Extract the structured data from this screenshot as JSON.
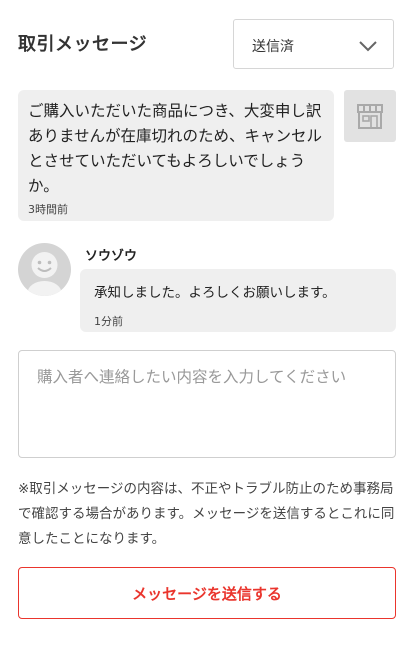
{
  "header": {
    "title": "取引メッセージ",
    "status_select": {
      "value": "送信済"
    }
  },
  "messages": [
    {
      "sender": "seller",
      "text": "ご購入いただいた商品につき、大変申し訳ありませんが在庫切れのため、キャンセルとさせていただいてもよろしいでしょうか。",
      "time": "3時間前",
      "avatar_icon": "shop-icon"
    },
    {
      "sender": "buyer",
      "name": "ソウゾウ",
      "text": "承知しました。よろしくお願いします。",
      "time": "1分前",
      "avatar_icon": "smiley-avatar-icon"
    }
  ],
  "compose": {
    "placeholder": "購入者へ連絡したい内容を入力してください",
    "value": ""
  },
  "notice": "※取引メッセージの内容は、不正やトラブル防止のため事務局で確認する場合があります。メッセージを送信するとこれに同意したことになります。",
  "send_button": {
    "label": "メッセージを送信する"
  },
  "colors": {
    "accent": "#ea352d",
    "bubble_bg": "#efefef",
    "avatar_bg": "#d4d4d4"
  }
}
